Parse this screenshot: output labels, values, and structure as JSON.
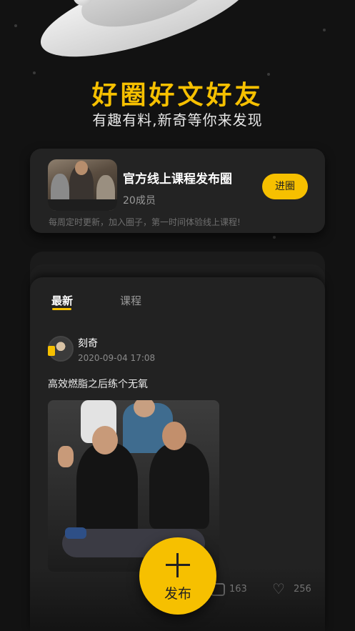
{
  "hero": {
    "title": "好圈好文好友",
    "subtitle": "有趣有料,新奇等你来发现"
  },
  "circle": {
    "name": "官方线上课程发布圈",
    "members": "20成员",
    "description": "每周定时更新，加入圈子，第一时间体验线上课程!",
    "join_label": "进圈"
  },
  "tabs": [
    {
      "label": "最新",
      "active": true
    },
    {
      "label": "课程",
      "active": false
    }
  ],
  "post": {
    "author": "刻奇",
    "time": "2020-09-04 17:08",
    "text": "高效燃脂之后练个无氧",
    "comments": "163",
    "likes": "256"
  },
  "fab": {
    "label": "发布"
  },
  "colors": {
    "accent": "#F6C000",
    "background": "#121212",
    "card": "#222222"
  }
}
